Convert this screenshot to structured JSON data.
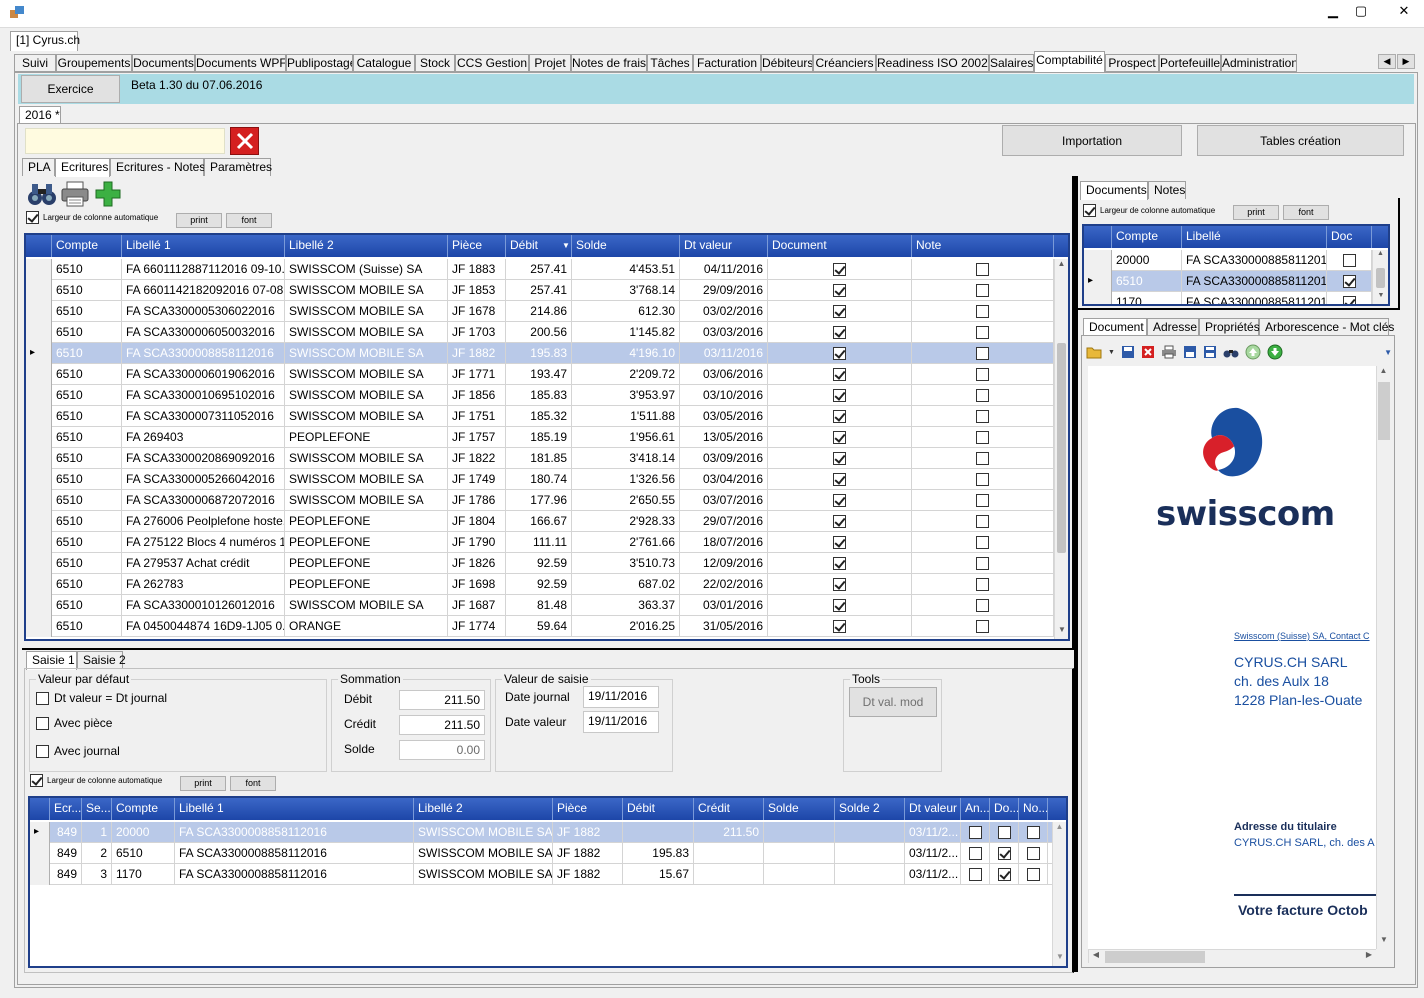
{
  "window": {
    "min": "▁",
    "max": "▢",
    "close": "✕"
  },
  "doc_tab": "[1] Cyrus.ch",
  "main_tabs": [
    "Suivi",
    "Groupements",
    "Documents",
    "Documents WPF",
    "Publipostage",
    "Catalogue",
    "Stock",
    "CCS Gestion",
    "Projet",
    "Notes de frais",
    "Tâches",
    "Facturation",
    "Débiteurs",
    "Créanciers",
    "Readiness ISO 20022",
    "Salaires",
    "Comptabilité",
    "Prospect",
    "Portefeuille",
    "Administration"
  ],
  "exercice_button": "Exercice",
  "version": "Beta 1.30 du 07.06.2016",
  "year_tab": "2016 *",
  "importation": "Importation",
  "tables_creation": "Tables création",
  "sub_tabs": [
    "PLA",
    "Ecritures",
    "Ecritures - Notes",
    "Paramètres"
  ],
  "auto_width": "Largeur de colonne automatique",
  "print": "print",
  "font": "font",
  "main_grid": {
    "headers": [
      "Compte",
      "Libellé 1",
      "Libellé 2",
      "Pièce",
      "Débit",
      "Solde",
      "Dt valeur",
      "Document",
      "Note"
    ],
    "rows": [
      {
        "compte": "6510",
        "lib1": "FA 6601112887112016 09-10...",
        "lib2": "SWISSCOM (Suisse) SA",
        "piece": "JF 1883",
        "debit": "257.41",
        "solde": "4'453.51",
        "dt": "04/11/2016",
        "doc": true,
        "note": false
      },
      {
        "compte": "6510",
        "lib1": "FA 6601142182092016 07-08...",
        "lib2": "SWISSCOM MOBILE SA",
        "piece": "JF 1853",
        "debit": "257.41",
        "solde": "3'768.14",
        "dt": "29/09/2016",
        "doc": true,
        "note": false
      },
      {
        "compte": "6510",
        "lib1": "FA SCA3300005306022016",
        "lib2": "SWISSCOM MOBILE SA",
        "piece": "JF 1678",
        "debit": "214.86",
        "solde": "612.30",
        "dt": "03/02/2016",
        "doc": true,
        "note": false
      },
      {
        "compte": "6510",
        "lib1": "FA SCA3300006050032016",
        "lib2": "SWISSCOM MOBILE SA",
        "piece": "JF 1703",
        "debit": "200.56",
        "solde": "1'145.82",
        "dt": "03/03/2016",
        "doc": true,
        "note": false
      },
      {
        "compte": "6510",
        "lib1": "FA SCA3300008858112016",
        "lib2": "SWISSCOM MOBILE SA",
        "piece": "JF 1882",
        "debit": "195.83",
        "solde": "4'196.10",
        "dt": "03/11/2016",
        "doc": true,
        "note": false,
        "selected": true
      },
      {
        "compte": "6510",
        "lib1": "FA SCA3300006019062016",
        "lib2": "SWISSCOM MOBILE SA",
        "piece": "JF 1771",
        "debit": "193.47",
        "solde": "2'209.72",
        "dt": "03/06/2016",
        "doc": true,
        "note": false
      },
      {
        "compte": "6510",
        "lib1": "FA SCA3300010695102016",
        "lib2": "SWISSCOM MOBILE SA",
        "piece": "JF 1856",
        "debit": "185.83",
        "solde": "3'953.97",
        "dt": "03/10/2016",
        "doc": true,
        "note": false
      },
      {
        "compte": "6510",
        "lib1": "FA SCA3300007311052016",
        "lib2": "SWISSCOM MOBILE SA",
        "piece": "JF 1751",
        "debit": "185.32",
        "solde": "1'511.88",
        "dt": "03/05/2016",
        "doc": true,
        "note": false
      },
      {
        "compte": "6510",
        "lib1": "FA 269403",
        "lib2": "PEOPLEFONE",
        "piece": "JF 1757",
        "debit": "185.19",
        "solde": "1'956.61",
        "dt": "13/05/2016",
        "doc": true,
        "note": false
      },
      {
        "compte": "6510",
        "lib1": "FA SCA3300020869092016",
        "lib2": "SWISSCOM MOBILE SA",
        "piece": "JF 1822",
        "debit": "181.85",
        "solde": "3'418.14",
        "dt": "03/09/2016",
        "doc": true,
        "note": false
      },
      {
        "compte": "6510",
        "lib1": "FA SCA3300005266042016",
        "lib2": "SWISSCOM MOBILE SA",
        "piece": "JF 1749",
        "debit": "180.74",
        "solde": "1'326.56",
        "dt": "03/04/2016",
        "doc": true,
        "note": false
      },
      {
        "compte": "6510",
        "lib1": "FA SCA3300006872072016",
        "lib2": "SWISSCOM MOBILE SA",
        "piece": "JF 1786",
        "debit": "177.96",
        "solde": "2'650.55",
        "dt": "03/07/2016",
        "doc": true,
        "note": false
      },
      {
        "compte": "6510",
        "lib1": "FA 276006 Peolplefone hoste...",
        "lib2": "PEOPLEFONE",
        "piece": "JF 1804",
        "debit": "166.67",
        "solde": "2'928.33",
        "dt": "29/07/2016",
        "doc": true,
        "note": false
      },
      {
        "compte": "6510",
        "lib1": "FA 275122 Blocs 4 numéros 1...",
        "lib2": "PEOPLEFONE",
        "piece": "JF 1790",
        "debit": "111.11",
        "solde": "2'761.66",
        "dt": "18/07/2016",
        "doc": true,
        "note": false
      },
      {
        "compte": "6510",
        "lib1": "FA 279537 Achat crédit",
        "lib2": "PEOPLEFONE",
        "piece": "JF 1826",
        "debit": "92.59",
        "solde": "3'510.73",
        "dt": "12/09/2016",
        "doc": true,
        "note": false
      },
      {
        "compte": "6510",
        "lib1": "FA 262783",
        "lib2": "PEOPLEFONE",
        "piece": "JF 1698",
        "debit": "92.59",
        "solde": "687.02",
        "dt": "22/02/2016",
        "doc": true,
        "note": false
      },
      {
        "compte": "6510",
        "lib1": "FA SCA3300010126012016",
        "lib2": "SWISSCOM MOBILE SA",
        "piece": "JF 1687",
        "debit": "81.48",
        "solde": "363.37",
        "dt": "03/01/2016",
        "doc": true,
        "note": false
      },
      {
        "compte": "6510",
        "lib1": "FA 0450044874 16D9-1J05 0...",
        "lib2": "ORANGE",
        "piece": "JF 1774",
        "debit": "59.64",
        "solde": "2'016.25",
        "dt": "31/05/2016",
        "doc": true,
        "note": false
      }
    ]
  },
  "saisie_tabs": [
    "Saisie 1",
    "Saisie 2"
  ],
  "valeur_defaut": {
    "title": "Valeur par défaut",
    "opts": [
      "Dt valeur = Dt journal",
      "Avec pièce",
      "Avec journal"
    ]
  },
  "sommation": {
    "title": "Sommation",
    "debit_label": "Débit",
    "debit": "211.50",
    "credit_label": "Crédit",
    "credit": "211.50",
    "solde_label": "Solde",
    "solde": "0.00"
  },
  "valeur_saisie": {
    "title": "Valeur de saisie",
    "dj_label": "Date journal",
    "dj": "19/11/2016",
    "dv_label": "Date valeur",
    "dv": "19/11/2016"
  },
  "tools": {
    "title": "Tools",
    "btn": "Dt val. mod"
  },
  "saisie_grid": {
    "headers": [
      "Ecr...",
      "Se...",
      "Compte",
      "Libellé 1",
      "Libellé 2",
      "Pièce",
      "Débit",
      "Crédit",
      "Solde",
      "Solde 2",
      "Dt valeur",
      "An...",
      "Do...",
      "No..."
    ],
    "rows": [
      {
        "ecr": "849",
        "se": "1",
        "compte": "20000",
        "lib1": "FA SCA3300008858112016",
        "lib2": "SWISSCOM MOBILE SA",
        "piece": "JF 1882",
        "debit": "",
        "credit": "211.50",
        "dt": "03/11/2...",
        "an": false,
        "do": false,
        "no": false,
        "selected": true
      },
      {
        "ecr": "849",
        "se": "2",
        "compte": "6510",
        "lib1": "FA SCA3300008858112016",
        "lib2": "SWISSCOM MOBILE SA",
        "piece": "JF 1882",
        "debit": "195.83",
        "credit": "",
        "dt": "03/11/2...",
        "an": false,
        "do": true,
        "no": false
      },
      {
        "ecr": "849",
        "se": "3",
        "compte": "1170",
        "lib1": "FA SCA3300008858112016",
        "lib2": "SWISSCOM MOBILE SA",
        "piece": "JF 1882",
        "debit": "15.67",
        "credit": "",
        "dt": "03/11/2...",
        "an": false,
        "do": true,
        "no": false
      }
    ]
  },
  "right_tabs": [
    "Documents",
    "Notes"
  ],
  "doc_grid": {
    "headers": [
      "Compte",
      "Libellé",
      "Doc"
    ],
    "rows": [
      {
        "compte": "20000",
        "lib": "FA SCA3300008858112016",
        "doc": false
      },
      {
        "compte": "6510",
        "lib": "FA SCA3300008858112016",
        "doc": true,
        "selected": true
      },
      {
        "compte": "1170",
        "lib": "FA SCA3300008858112016",
        "doc": true
      }
    ]
  },
  "preview_tabs": [
    "Document",
    "Adresse",
    "Propriétés",
    "Arborescence - Mot clés"
  ],
  "preview": {
    "logo": "swisscom",
    "sender": "Swisscom (Suisse) SA, Contact C",
    "addr1": "CYRUS.CH SARL",
    "addr2": "ch. des Aulx 18",
    "addr3": "1228 Plan-les-Ouate",
    "titulaire_label": "Adresse du titulaire",
    "titulaire": "CYRUS.CH SARL, ch. des A",
    "facture": "Votre facture Octob"
  }
}
